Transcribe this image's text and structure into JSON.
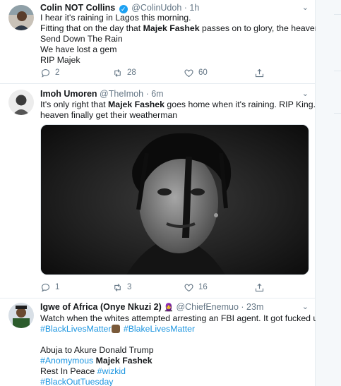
{
  "tweets": [
    {
      "name": "Colin NOT Collins",
      "verified": true,
      "handle": "@ColinUdoh",
      "sep": "·",
      "time": "1h",
      "lines": [
        "I hear it's raining in Lagos this morning.",
        [
          "Fitting that on the day that ",
          "Majek Fashek",
          " passes on to glory, the heavens"
        ],
        "Send Down The Rain",
        "We have lost a gem",
        "RIP Majek"
      ],
      "replies": "2",
      "retweets": "28",
      "likes": "60"
    },
    {
      "name": "Imoh Umoren",
      "handle": "@TheImoh",
      "sep": "·",
      "time": "6m",
      "lines": [
        [
          "It's only right that ",
          "Majek Fashek",
          " goes home when it's raining. RIP King... The"
        ],
        "heaven finally get their weatherman"
      ],
      "replies": "1",
      "retweets": "3",
      "likes": "16"
    },
    {
      "name": "Igwe of Africa (Onye Nkuzi 2)",
      "handle": "@ChiefEnemuo",
      "sep": "·",
      "time": "23m",
      "line1": "Watch when the whites attempted arresting an FBI agent. It got fucked up.",
      "tag1": "#BlackLivesMatter",
      "tag2": "#BlakeLivesMatter",
      "line3": "Abuja to Akure Donald Trump",
      "tag3": "#Anomymous",
      "bold3": "Majek Fashek",
      "line5": "Rest In Peace",
      "tag4": "#wizkid",
      "tag5": "#BlackOutTuesday"
    }
  ],
  "icons": {
    "reply": "reply-icon",
    "retweet": "retweet-icon",
    "like": "heart-icon",
    "share": "share-icon",
    "caret": "chevron-down-icon",
    "verified": "verified-badge-icon"
  },
  "colors": {
    "text": "#14171a",
    "muted": "#657786",
    "link": "#1b95e0",
    "verified": "#1da1f2",
    "border": "#e6ecf0"
  }
}
